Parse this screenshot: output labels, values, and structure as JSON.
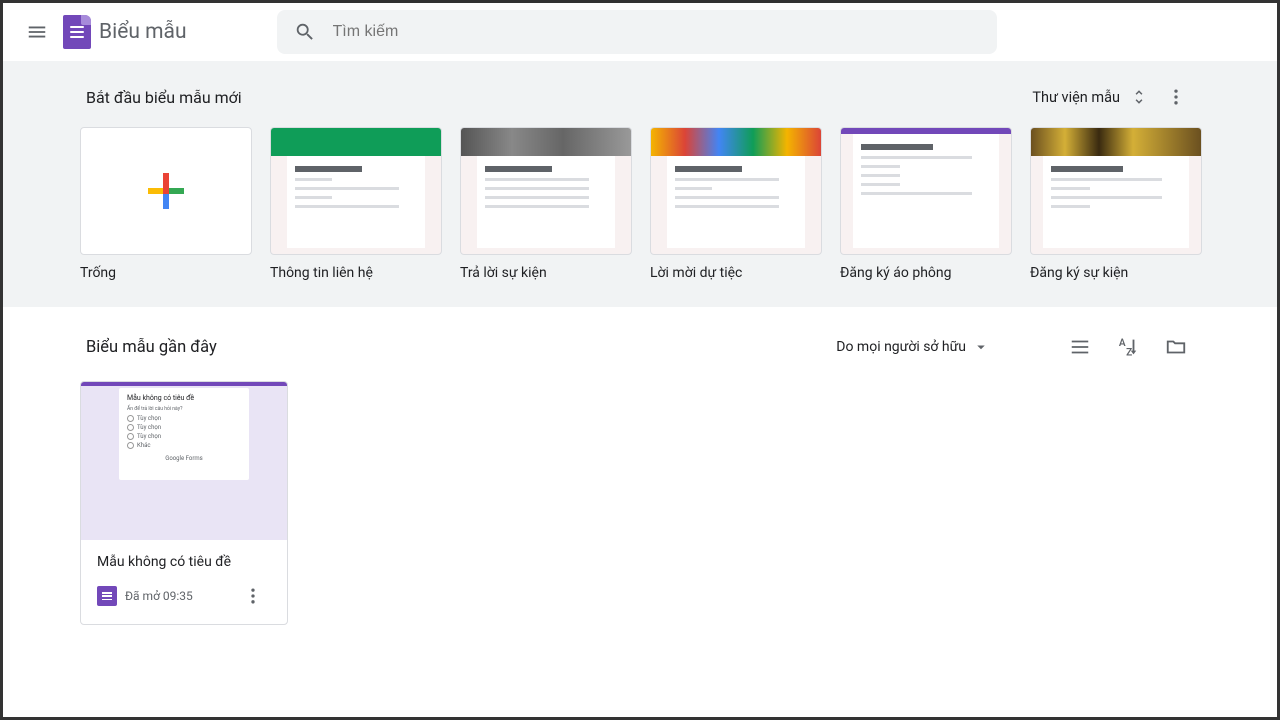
{
  "header": {
    "app_title": "Biểu mẫu",
    "search_placeholder": "Tìm kiếm"
  },
  "templates": {
    "section_title": "Bắt đầu biểu mẫu mới",
    "gallery_label": "Thư viện mẫu",
    "items": [
      {
        "label": "Trống"
      },
      {
        "label": "Thông tin liên hệ"
      },
      {
        "label": "Trả lời sự kiện"
      },
      {
        "label": "Lời mời dự tiệc"
      },
      {
        "label": "Đăng ký áo phông"
      },
      {
        "label": "Đăng ký sự kiện"
      }
    ]
  },
  "recent": {
    "section_title": "Biểu mẫu gần đây",
    "owner_filter": "Do mọi người sở hữu",
    "docs": [
      {
        "name": "Mẫu không có tiêu đề",
        "opened": "Đã mở 09:35"
      }
    ]
  }
}
